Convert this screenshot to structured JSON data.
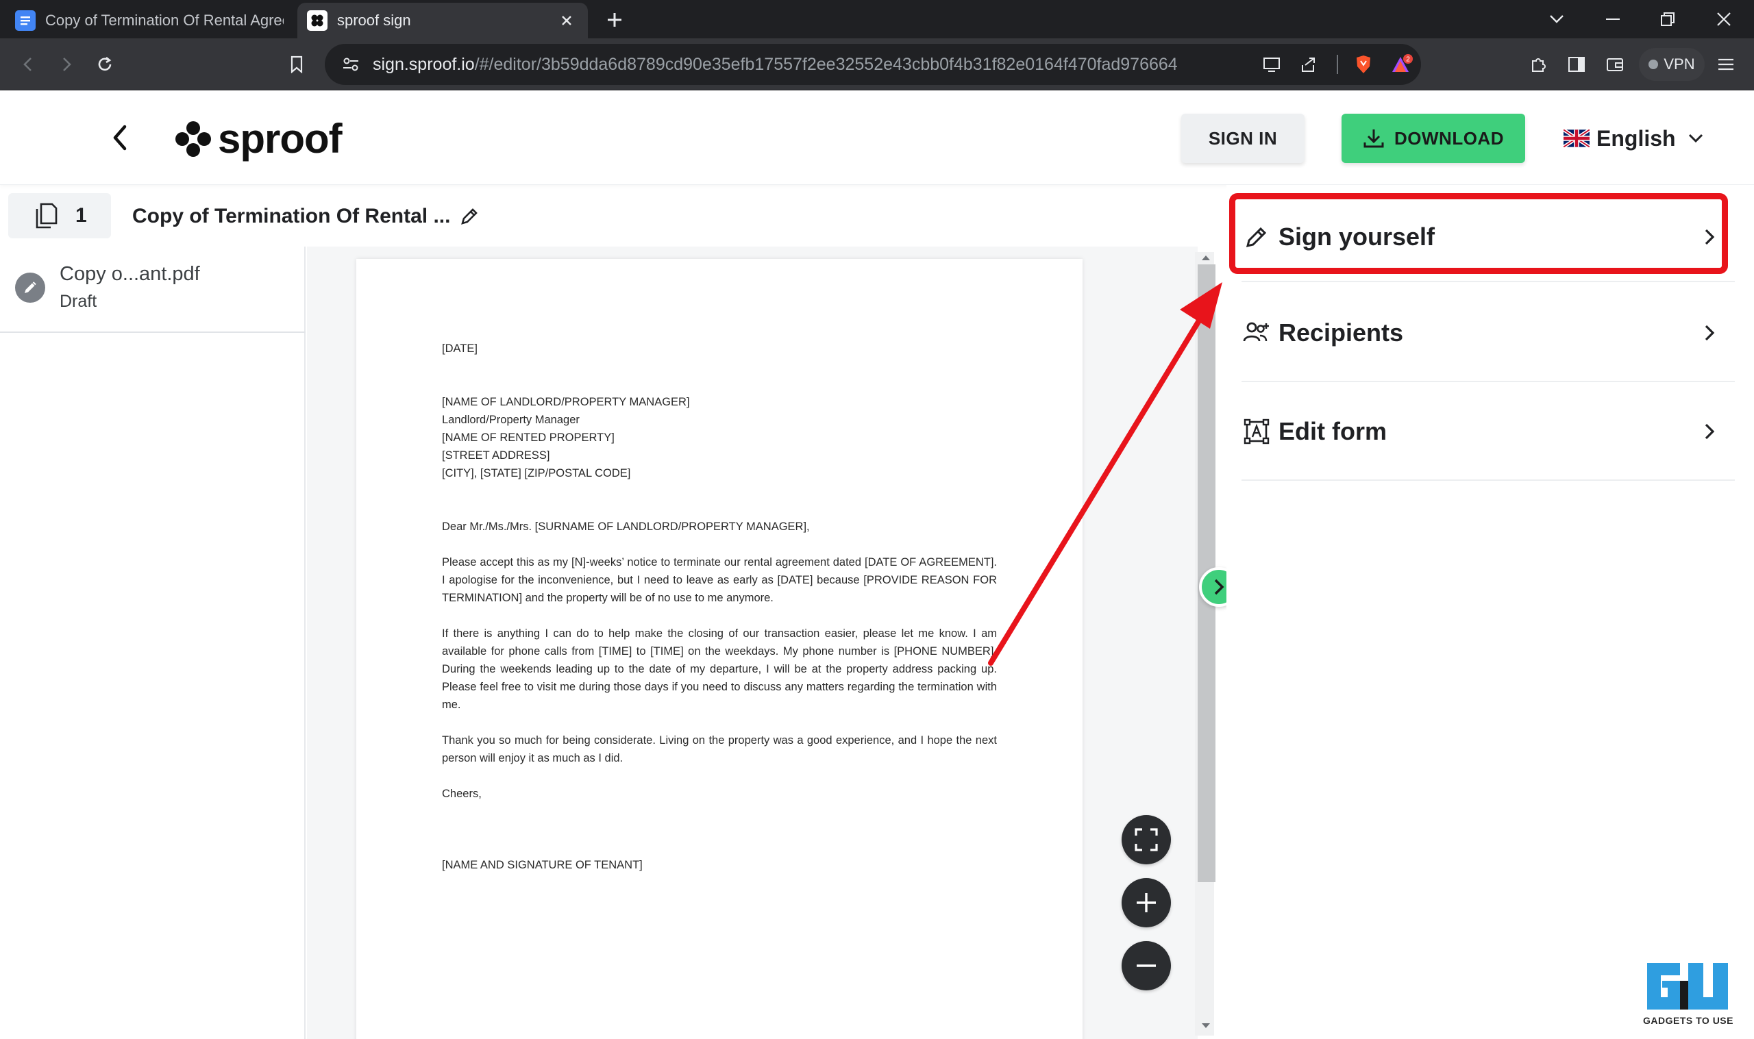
{
  "browser": {
    "tabs": [
      {
        "title": "Copy of Termination Of Rental Agreem"
      },
      {
        "title": "sproof sign"
      }
    ],
    "url": {
      "host": "sign.sproof.io",
      "path": "/#/editor/3b59dda6d8789cd90e35efb17557f2ee32552e43cbb0f4b31f82e0164f470fad976664"
    },
    "vpn_label": "VPN",
    "notification_count": "2"
  },
  "header": {
    "logo_text": "sproof",
    "signin_label": "SIGN IN",
    "download_label": "DOWNLOAD",
    "language": "English"
  },
  "document": {
    "page_count": "1",
    "title": "Copy of Termination Of Rental ..."
  },
  "file_list": [
    {
      "name": "Copy o...ant.pdf",
      "status": "Draft"
    }
  ],
  "letter": {
    "date": "[DATE]",
    "address": [
      "[NAME OF LANDLORD/PROPERTY MANAGER]",
      "Landlord/Property Manager",
      "[NAME OF RENTED PROPERTY]",
      "[STREET ADDRESS]",
      "[CITY], [STATE] [ZIP/POSTAL CODE]"
    ],
    "salutation": "Dear Mr./Ms./Mrs. [SURNAME OF LANDLORD/PROPERTY MANAGER],",
    "paragraph1": "Please accept this as my [N]-weeks’ notice to terminate our rental agreement dated [DATE OF AGREEMENT]. I apologise for the inconvenience, but I need to leave as early as [DATE] because [PROVIDE REASON FOR TERMINATION] and the property will be of no use to me anymore.",
    "paragraph2": "If there is anything I can do to help make the closing of our transaction easier, please let me know. I am available for phone calls from [TIME] to [TIME] on the weekdays. My phone number is [PHONE NUMBER]. During the weekends leading up to the date of my departure, I will be at the property address packing up. Please feel free to visit me during those days if you need to discuss any matters regarding the termination with me.",
    "paragraph3": "Thank you so much for being considerate. Living on the property was a good experience, and I hope the next person will enjoy it as much as I did.",
    "closing": "Cheers,",
    "signature": "[NAME AND SIGNATURE OF TENANT]"
  },
  "actions": [
    {
      "label": "Sign yourself",
      "icon": "pencil-icon"
    },
    {
      "label": "Recipients",
      "icon": "recipients-icon"
    },
    {
      "label": "Edit form",
      "icon": "edit-form-icon"
    }
  ],
  "watermark_text": "GADGETS TO USE",
  "colors": {
    "accent_green": "#3fcf7c",
    "highlight_red": "#e8141b",
    "browser_dark": "#1f2023"
  }
}
